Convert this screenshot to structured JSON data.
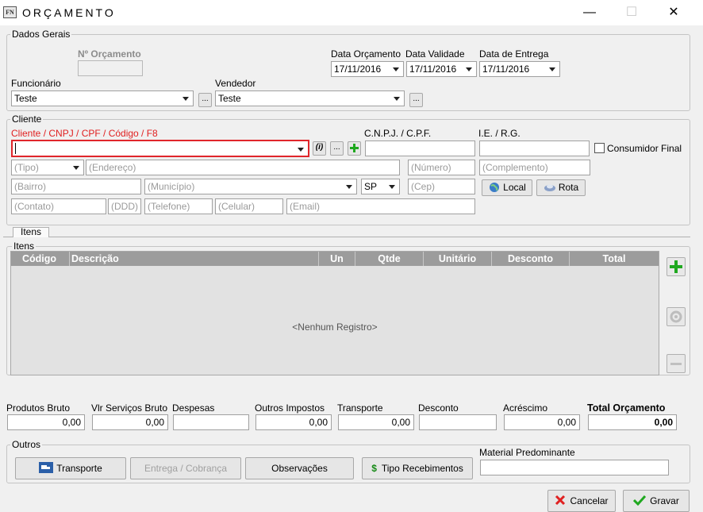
{
  "window": {
    "title": "ORÇAMENTO",
    "icon_text": "FN",
    "minimize": "—",
    "maximize": "☐",
    "close": "✕"
  },
  "dados_gerais": {
    "legend": "Dados Gerais",
    "num_orcamento_label": "Nº Orçamento",
    "num_orcamento_value": "",
    "data_orcamento_label": "Data Orçamento",
    "data_orcamento_value": "17/11/2016",
    "data_validade_label": "Data Validade",
    "data_validade_value": "17/11/2016",
    "data_entrega_label": "Data de Entrega",
    "data_entrega_value": "17/11/2016",
    "funcionario_label": "Funcionário",
    "funcionario_value": "Teste",
    "vendedor_label": "Vendedor",
    "vendedor_value": "Teste",
    "ellipsis": "..."
  },
  "cliente": {
    "legend": "Cliente",
    "search_label": "Cliente / CNPJ / CPF / Código / F8",
    "search_value": "",
    "info_button": "(i)",
    "ellipsis": "...",
    "cnpj_label": "C.N.P.J. / C.P.F.",
    "ie_label": "I.E. / R.G.",
    "consumidor_final_label": "Consumidor Final",
    "placeholders": {
      "tipo": "(Tipo)",
      "endereco": "(Endereço)",
      "numero": "(Número)",
      "complemento": "(Complemento)",
      "bairro": "(Bairro)",
      "municipio": "(Município)",
      "cep": "(Cep)",
      "contato": "(Contato)",
      "ddd": "(DDD)",
      "telefone": "(Telefone)",
      "celular": "(Celular)",
      "email": "(Email)"
    },
    "uf_value": "SP",
    "local_button": "Local",
    "rota_button": "Rota"
  },
  "itens": {
    "tab_label": "Itens",
    "group_label": "Itens",
    "columns": [
      "Código",
      "Descrição",
      "Un",
      "Qtde",
      "Unitário",
      "Desconto",
      "Total"
    ],
    "empty_text": "<Nenhum Registro>"
  },
  "totals": [
    {
      "label": "Produtos Bruto",
      "value": "0,00",
      "bold": false
    },
    {
      "label": "Vlr Serviços Bruto",
      "value": "0,00",
      "bold": false
    },
    {
      "label": "Despesas",
      "value": "",
      "bold": false
    },
    {
      "label": "Outros Impostos",
      "value": "0,00",
      "bold": false
    },
    {
      "label": "Transporte",
      "value": "0,00",
      "bold": false
    },
    {
      "label": "Desconto",
      "value": "",
      "bold": false
    },
    {
      "label": "Acréscimo",
      "value": "0,00",
      "bold": false
    },
    {
      "label": "Total Orçamento",
      "value": "0,00",
      "bold": true
    }
  ],
  "outros": {
    "legend": "Outros",
    "transporte_button": "Transporte",
    "entrega_button": "Entrega / Cobrança",
    "observacoes_button": "Observações",
    "tipo_recebimentos_button": "Tipo Recebimentos",
    "material_label": "Material Predominante",
    "material_value": ""
  },
  "footer": {
    "cancelar_button": "Cancelar",
    "gravar_button": "Gravar"
  },
  "colors": {
    "required_red": "#e02020",
    "grid_header": "#9c9c9c",
    "add_green": "#1fa81f"
  }
}
